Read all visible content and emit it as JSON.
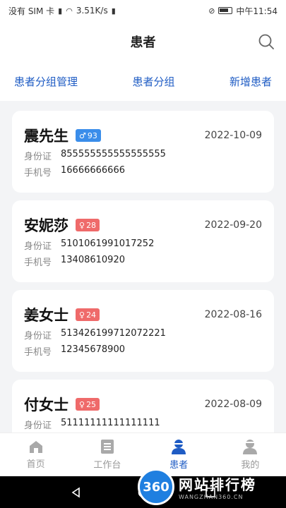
{
  "status_bar": {
    "carrier": "没有 SIM 卡",
    "speed": "3.51K/s",
    "time": "中午11:54"
  },
  "header": {
    "title": "患者"
  },
  "actions": {
    "group_manage": "患者分组管理",
    "group": "患者分组",
    "add": "新增患者"
  },
  "labels": {
    "id_card": "身份证",
    "phone": "手机号"
  },
  "patients": [
    {
      "name": "震先生",
      "gender_icon": "male-icon",
      "gender_symbol": "♂",
      "age": "93",
      "date": "2022-10-09",
      "id_card": "855555555555555555",
      "phone": "16666666666"
    },
    {
      "name": "安妮莎",
      "gender_icon": "female-icon",
      "gender_symbol": "♀",
      "age": "28",
      "date": "2022-09-20",
      "id_card": "5101061991017252",
      "phone": "13408610920"
    },
    {
      "name": "姜女士",
      "gender_icon": "female-icon",
      "gender_symbol": "♀",
      "age": "24",
      "date": "2022-08-16",
      "id_card": "513426199712072221",
      "phone": "12345678900"
    },
    {
      "name": "付女士",
      "gender_icon": "female-icon",
      "gender_symbol": "♀",
      "age": "25",
      "date": "2022-08-09",
      "id_card": "51111111111111111",
      "phone": ""
    }
  ],
  "tabs": [
    {
      "label": "首页",
      "icon": "home-icon"
    },
    {
      "label": "工作台",
      "icon": "workbench-icon"
    },
    {
      "label": "患者",
      "icon": "patient-icon",
      "active": true
    },
    {
      "label": "我的",
      "icon": "profile-icon"
    }
  ],
  "colors": {
    "accent": "#1f5cc4",
    "male": "#3a8dea",
    "female": "#ef6a6a"
  },
  "watermark": {
    "badge": "360",
    "title": "网站排行榜",
    "subtitle": "WANGZHAN360.CN"
  }
}
